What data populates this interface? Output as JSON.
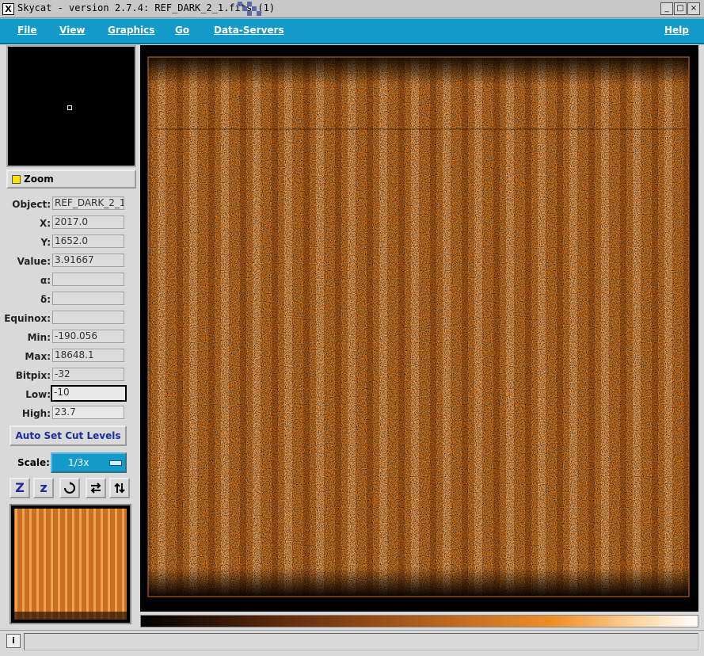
{
  "window": {
    "title": "Skycat - version 2.7.4: REF_DARK_2_1.fits (1)"
  },
  "menu": {
    "file": "File",
    "view": "View",
    "graphics": "Graphics",
    "go": "Go",
    "data_servers": "Data-Servers",
    "help": "Help"
  },
  "zoom": {
    "label": "Zoom"
  },
  "info": {
    "object_label": "Object:",
    "object": "REF_DARK_2_1",
    "x_label": "X:",
    "x": "2017.0",
    "y_label": "Y:",
    "y": "1652.0",
    "value_label": "Value:",
    "value": "3.91667",
    "alpha_label": "α:",
    "alpha": "",
    "delta_label": "δ:",
    "delta": "",
    "equinox_label": "Equinox:",
    "equinox": "",
    "min_label": "Min:",
    "min": "-190.056",
    "max_label": "Max:",
    "max": "18648.1",
    "bitpix_label": "Bitpix:",
    "bitpix": "-32",
    "low_label": "Low:",
    "low": "-10",
    "high_label": "High:",
    "high": "23.7"
  },
  "buttons": {
    "auto_cut": "Auto Set Cut Levels"
  },
  "scale": {
    "label": "Scale:",
    "value": "1/3x"
  },
  "tools": {
    "zoom_in": "Z",
    "zoom_out": "z"
  },
  "status": {
    "info_icon": "i",
    "message": ""
  },
  "colors": {
    "menubar": "#139ac9",
    "image": "#e8892e"
  }
}
